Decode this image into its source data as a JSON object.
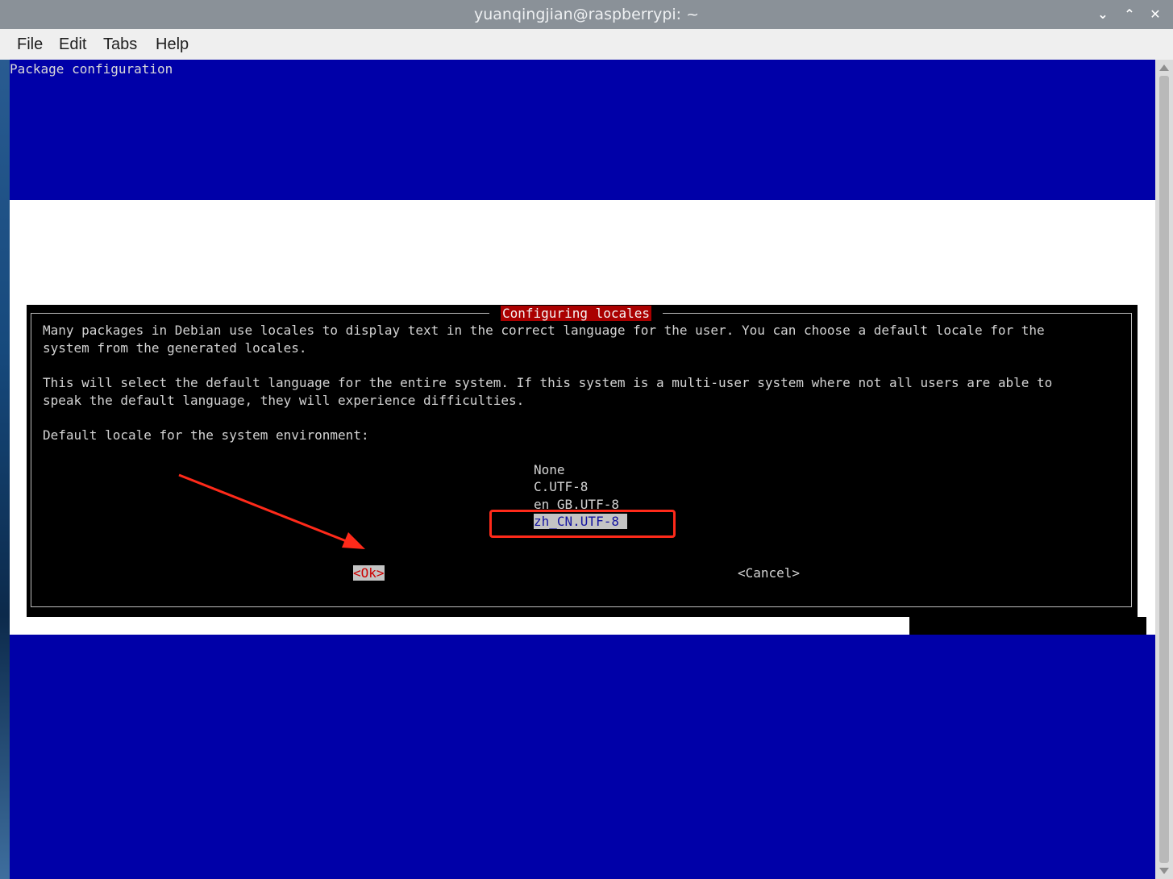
{
  "window": {
    "title": "yuanqingjian@raspberrypi: ~",
    "controls": [
      {
        "name": "minimize",
        "glyph": "⌄"
      },
      {
        "name": "maximize",
        "glyph": "⌃"
      },
      {
        "name": "close",
        "glyph": "✕"
      }
    ]
  },
  "menu": {
    "items": [
      "File",
      "Edit",
      "Tabs",
      "Help"
    ]
  },
  "terminal": {
    "header": "Package configuration",
    "colors": {
      "background": "#0000a8",
      "dialog_bg": "#000000",
      "title_bg": "#aa0000",
      "selection_bg": "#c4c4c4",
      "annotation": "#ff2a1a"
    }
  },
  "dialog": {
    "title": "Configuring locales",
    "paragraph1_line1": "Many packages in Debian use locales to display text in the correct language for the user. You can choose a default locale for the",
    "paragraph1_line2": "system from the generated locales.",
    "paragraph2_line1": "This will select the default language for the entire system. If this system is a multi-user system where not all users are able to",
    "paragraph2_line2": "speak the default language, they will experience difficulties.",
    "prompt": "Default locale for the system environment:",
    "options": [
      "None",
      "C.UTF-8",
      "en_GB.UTF-8",
      "zh_CN.UTF-8"
    ],
    "selected_option": "zh_CN.UTF-8",
    "ok_label": "<Ok>",
    "cancel_label": "<Cancel>"
  },
  "annotations": {
    "arrow_icon": "red-arrow-icon",
    "highlight_box": "red-highlight-box"
  }
}
